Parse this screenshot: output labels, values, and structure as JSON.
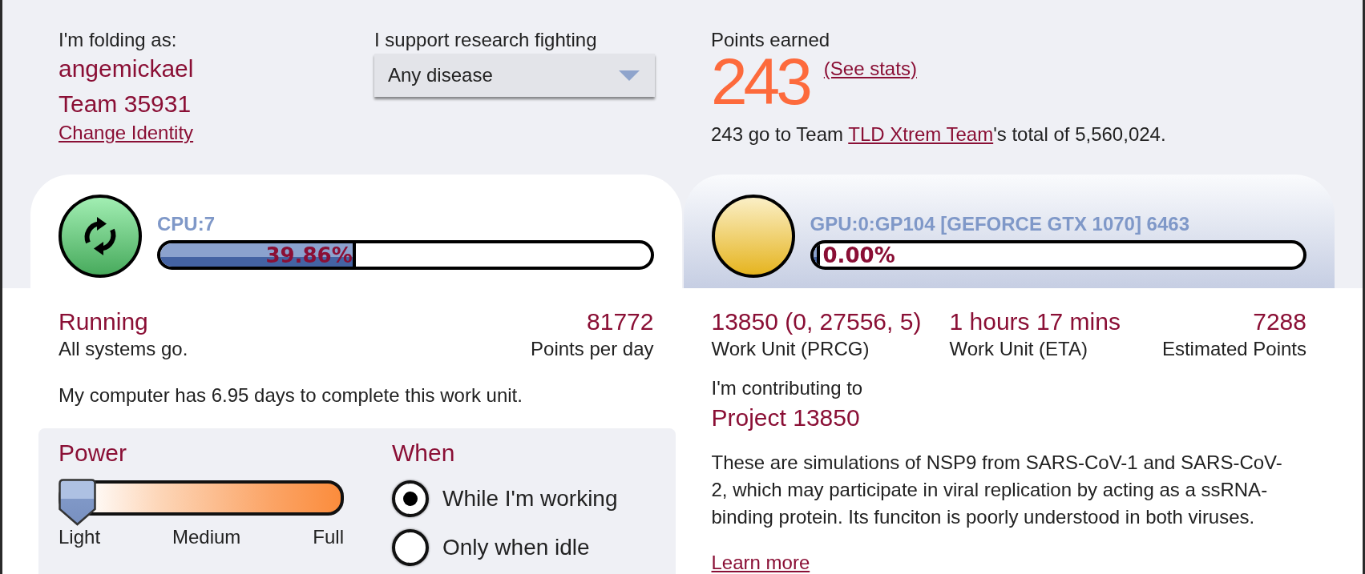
{
  "identity": {
    "label": "I'm folding as:",
    "name": "angemickael",
    "team": "Team 35931",
    "change_link": "Change Identity"
  },
  "cause": {
    "label": "I support research fighting",
    "value": "Any disease"
  },
  "points": {
    "label": "Points earned",
    "value": "243",
    "stats_link": "(See stats)",
    "team_text_start": "243 go to Team",
    "team_link": "TLD Xtrem Team",
    "team_text_end": "'s total of 5,560,024."
  },
  "slots": [
    {
      "kind": "running",
      "selected": true,
      "name": "CPU:7",
      "level": 0.3986,
      "percent": "39.86%"
    },
    {
      "kind": "waiting",
      "selected": false,
      "name": "GPU:0:GP104 [GEFORCE GTX 1070] 6463",
      "level": 0,
      "percent": "0.00%"
    }
  ],
  "status": {
    "title": "Running",
    "detail": "All systems go.",
    "ppd": "81772",
    "ppd_label": "Points per day",
    "eta_text": "My computer has 6.95 days to complete this work unit."
  },
  "settings": {
    "power": {
      "title": "Power",
      "level": 0,
      "labels": [
        "Light",
        "Medium",
        "Full"
      ]
    },
    "when": {
      "title": "When",
      "options": [
        {
          "label": "While I'm working",
          "selected": true
        },
        {
          "label": "Only when idle",
          "selected": false
        }
      ]
    }
  },
  "work_unit": {
    "stats": [
      {
        "value": "13850 (0, 27556, 5)",
        "label": "Work Unit (PRCG)"
      },
      {
        "value": "1 hours 17 mins",
        "label": "Work Unit (ETA)"
      },
      {
        "value": "7288",
        "label": "Estimated Points"
      }
    ],
    "contributing_label": "I'm contributing to",
    "project": "Project 13850",
    "description": "These are simulations of NSP9 from SARS-CoV-1 and SARS-CoV-2, which may participate in viral replication by acting as a ssRNA-binding protein. Its funciton is poorly understood in both viruses.",
    "learn_more": "Learn more"
  }
}
